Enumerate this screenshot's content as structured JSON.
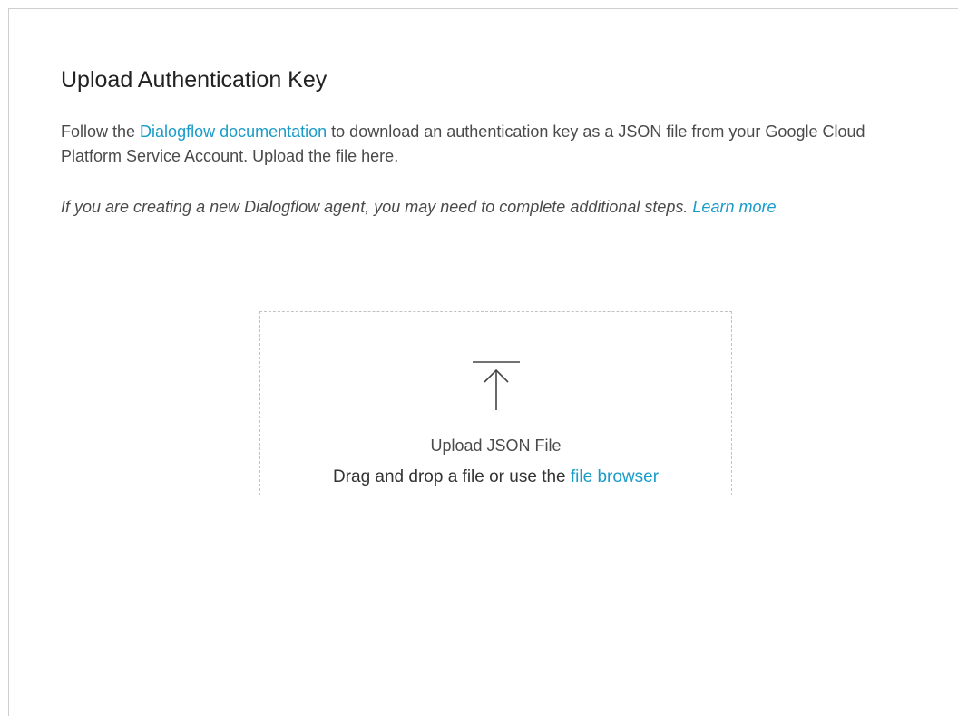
{
  "dialog": {
    "title": "Upload Authentication Key",
    "description": {
      "before_link": "Follow the ",
      "link_text": "Dialogflow documentation",
      "after_link": " to download an authentication key as a JSON file from your Google Cloud Platform Service Account. Upload the file here."
    },
    "note": {
      "text": "If you are creating a new Dialogflow agent, you may need to complete additional steps. ",
      "link_text": "Learn more"
    }
  },
  "dropzone": {
    "icon": "upload-icon",
    "title": "Upload JSON File",
    "instruction": "Drag and drop a file or use the ",
    "browse_link": "file browser"
  },
  "colors": {
    "link": "#1a9bc9",
    "text": "#4a4a4a",
    "title": "#222222",
    "border": "#c2c2c2"
  }
}
